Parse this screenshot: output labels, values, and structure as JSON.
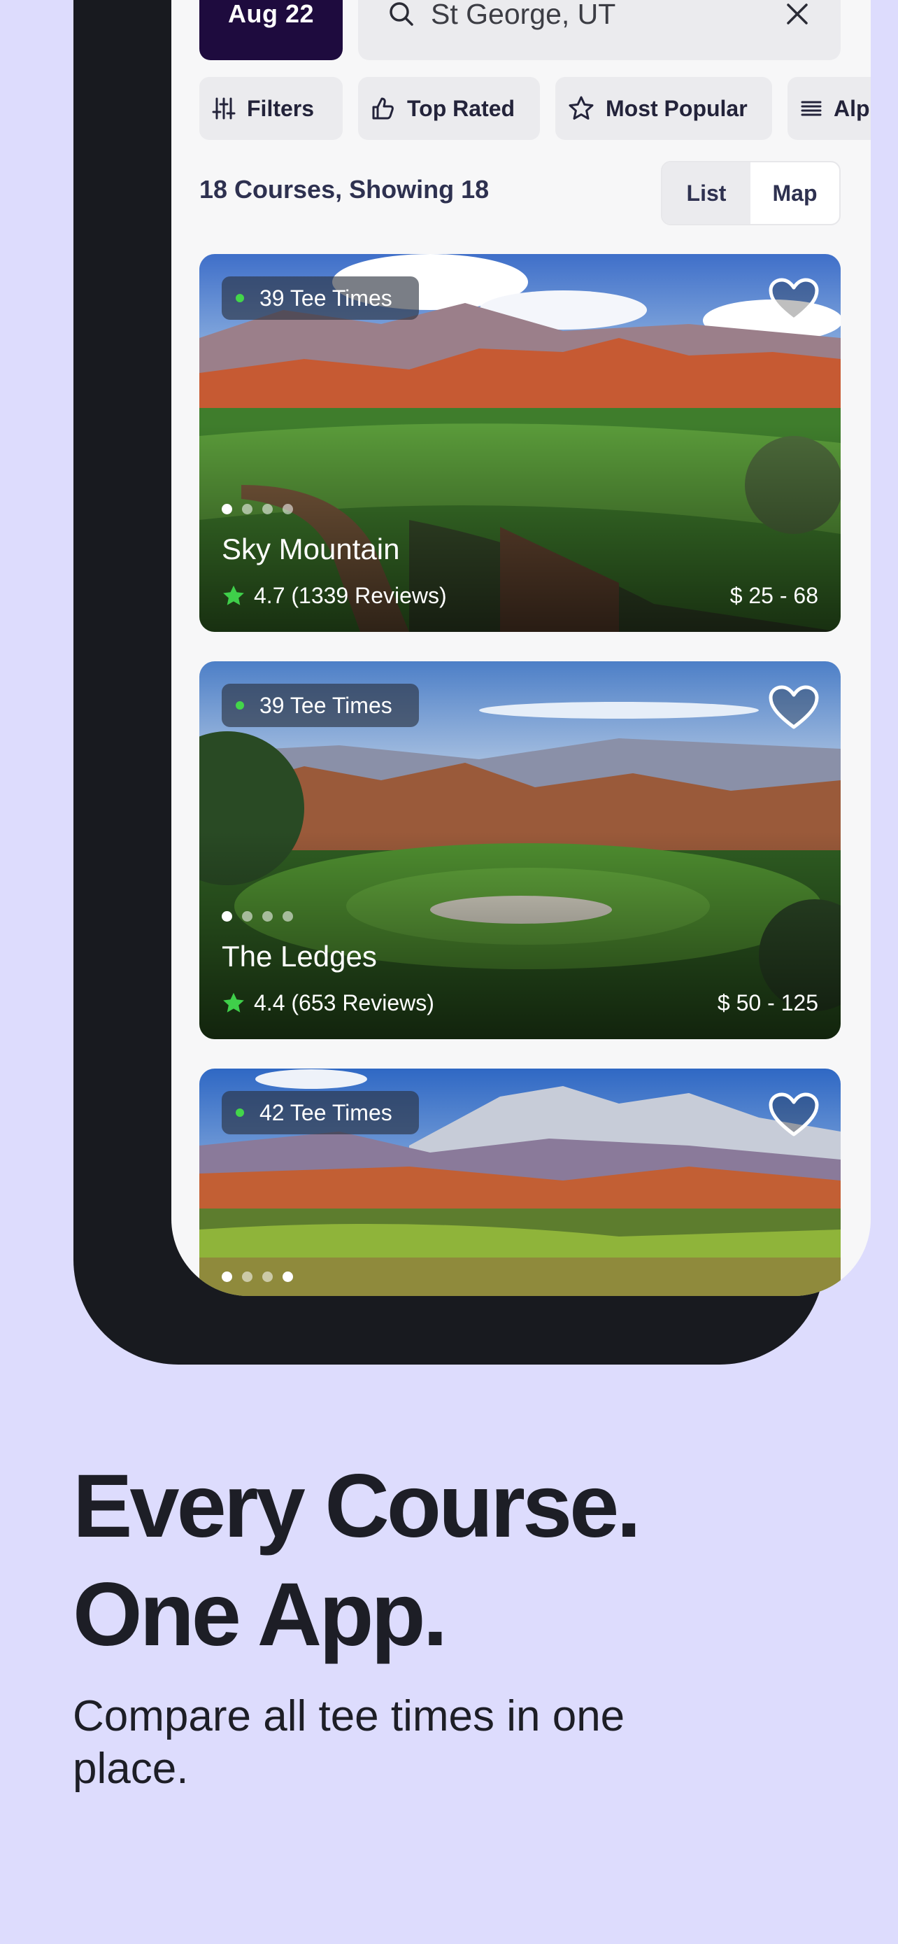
{
  "search_bar": {
    "date": "Aug 22",
    "location": "St George, UT"
  },
  "filters": [
    {
      "label": "Filters",
      "icon": "sliders-icon"
    },
    {
      "label": "Top Rated",
      "icon": "thumbs-up-icon"
    },
    {
      "label": "Most Popular",
      "icon": "star-outline-icon"
    },
    {
      "label": "Alp",
      "icon": "list-icon"
    }
  ],
  "results": {
    "summary": "18 Courses, Showing 18",
    "view_options": [
      "List",
      "Map"
    ],
    "selected_view": "List"
  },
  "courses": [
    {
      "tee_times": "39 Tee Times",
      "name": "Sky Mountain",
      "rating": "4.7 (1339 Reviews)",
      "price": "$ 25 - 68",
      "photo_index": 1,
      "photo_count": 4
    },
    {
      "tee_times": "39 Tee Times",
      "name": "The Ledges",
      "rating": "4.4 (653 Reviews)",
      "price": "$ 50 - 125",
      "photo_index": 1,
      "photo_count": 4
    },
    {
      "tee_times": "42 Tee Times",
      "name": "",
      "rating": "",
      "price": "",
      "photo_index": 4,
      "photo_count": 4
    }
  ],
  "marketing": {
    "headline_line1": "Every Course.",
    "headline_line2": "One App.",
    "subtext": "Compare all tee times in one place."
  },
  "colors": {
    "background": "#dddcfd",
    "date_button": "#1e0b3e",
    "availability_dot": "#43d64a",
    "rating_star": "#3fcf4a",
    "text_dark": "#1d1e26"
  }
}
